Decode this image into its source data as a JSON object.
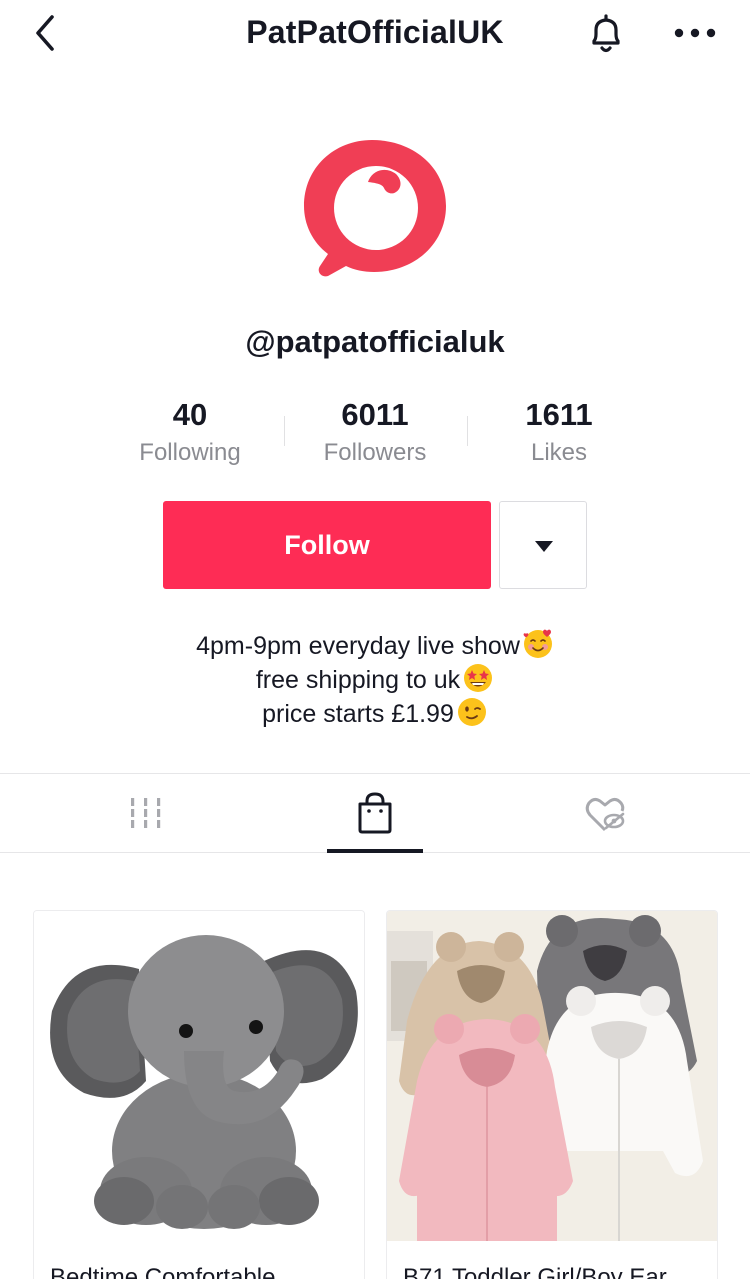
{
  "header": {
    "title": "PatPatOfficialUK",
    "back_icon": "chevron-left-icon",
    "bell_icon": "bell-icon",
    "more_icon": "more-horizontal-icon"
  },
  "profile": {
    "avatar_icon": "patpat-logo",
    "handle": "@patpatofficialuk",
    "brand_color": "#f03e55"
  },
  "stats": [
    {
      "value": "40",
      "label": "Following"
    },
    {
      "value": "6011",
      "label": "Followers"
    },
    {
      "value": "1611",
      "label": "Likes"
    }
  ],
  "actions": {
    "follow_label": "Follow",
    "follow_color": "#fe2c55",
    "dropdown_icon": "caret-down-icon"
  },
  "bio": {
    "line1": "4pm-9pm everyday live show",
    "line2": "free shipping to uk",
    "line3": "price starts £1.99",
    "emoji1": "smiling-face-with-hearts",
    "emoji2": "star-struck",
    "emoji3": "winking-face"
  },
  "tabs": {
    "items": [
      "videos-grid-icon",
      "shopping-bag-icon",
      "liked-hidden-icon"
    ],
    "active_index": 1
  },
  "products": [
    {
      "title": "Bedtime Comfortable",
      "image": "gray-elephant-plush-toy"
    },
    {
      "title": "B71 Toddler Girl/Boy Ear",
      "image": "toddler-fleece-hoodie-jackets"
    }
  ]
}
